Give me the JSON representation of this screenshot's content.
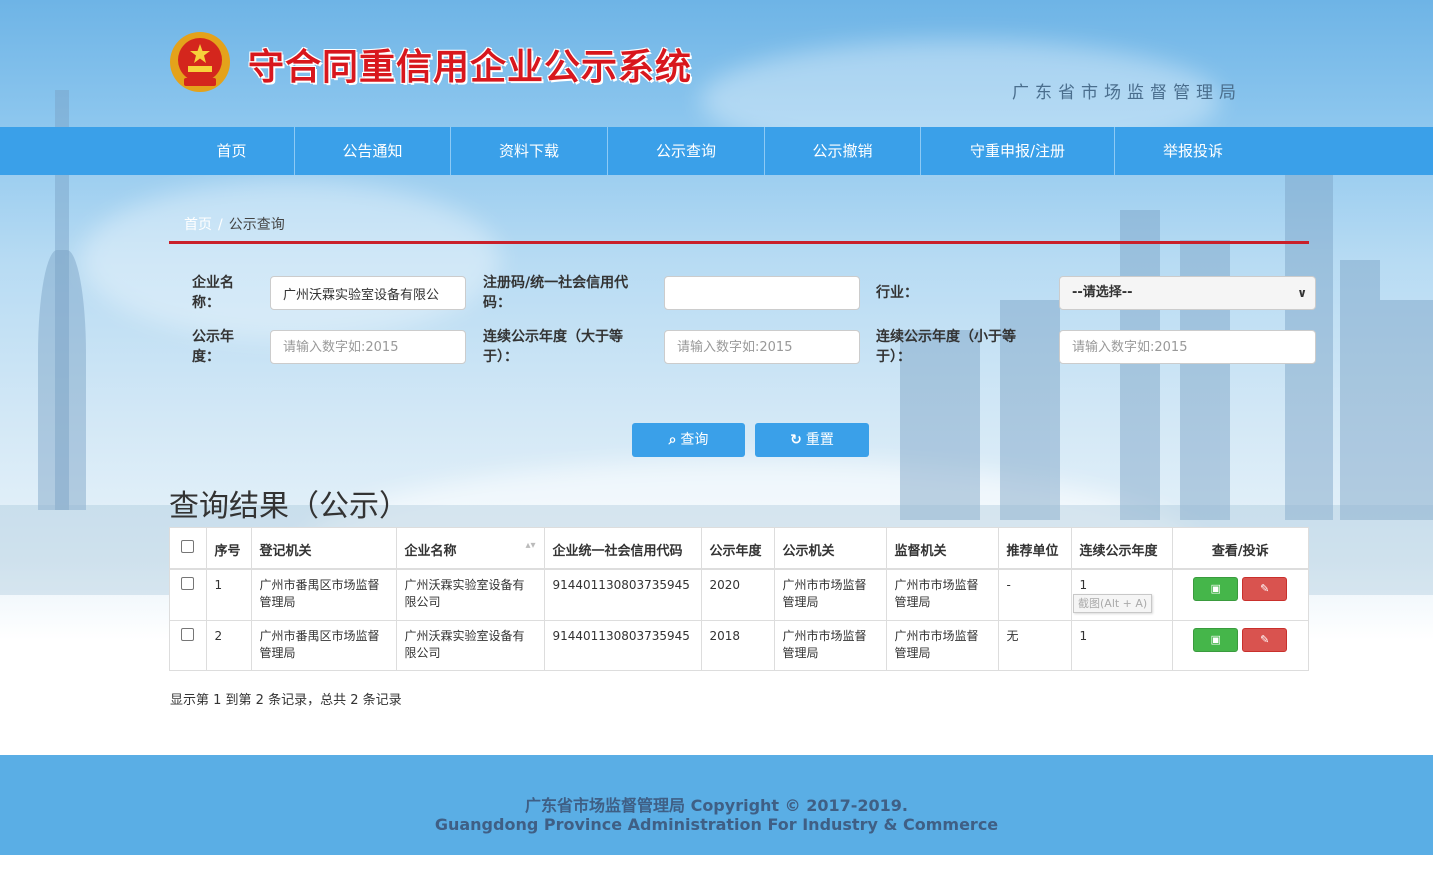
{
  "header": {
    "title": "守合同重信用企业公示系统",
    "subtitle": "广东省市场监督管理局"
  },
  "nav": {
    "items": [
      "首页",
      "公告通知",
      "资料下载",
      "公示查询",
      "公示撤销",
      "守重申报/注册",
      "举报投诉"
    ]
  },
  "breadcrumb": {
    "home": "首页",
    "sep": "/",
    "current": "公示查询"
  },
  "form": {
    "company_name_label_1": "企业名",
    "company_name_label_2": "称：",
    "company_name_value": "广州沃霖实验室设备有限公",
    "reg_code_label_1": "注册码/统一社会信用代",
    "reg_code_label_2": "码：",
    "reg_code_value": "",
    "industry_label": "行业：",
    "industry_selected": "--请选择--",
    "year_label_1": "公示年",
    "year_label_2": "度：",
    "year_placeholder": "请输入数字如:2015",
    "consec_gt_label_1": "连续公示年度（大于等",
    "consec_gt_label_2": "于）：",
    "consec_gt_placeholder": "请输入数字如:2015",
    "consec_lt_label_1": "连续公示年度（小于等",
    "consec_lt_label_2": "于）：",
    "consec_lt_placeholder": "请输入数字如:2015",
    "search_button": "查询",
    "reset_button": "重置"
  },
  "results": {
    "title": "查询结果（公示）",
    "columns": [
      "序号",
      "登记机关",
      "企业名称",
      "企业统一社会信用代码",
      "公示年度",
      "公示机关",
      "监督机关",
      "推荐单位",
      "连续公示年度",
      "查看/投诉"
    ],
    "rows": [
      {
        "no": "1",
        "reg_authority": "广州市番禺区市场监督管理局",
        "company": "广州沃霖实验室设备有限公司",
        "credit_code": "91440113080373594​5",
        "year": "2020",
        "publish_authority": "广州市市场监督管理局",
        "supervise_authority": "广州市市场监督管理局",
        "recommender": "-",
        "consecutive": "1"
      },
      {
        "no": "2",
        "reg_authority": "广州市番禺区市场监督管理局",
        "company": "广州沃霖实验室设备有限公司",
        "credit_code": "914401130803735945",
        "year": "2018",
        "publish_authority": "广州市市场监督管理局",
        "supervise_authority": "广州市市场监督管理局",
        "recommender": "无",
        "consecutive": "1"
      }
    ],
    "tooltip": "截图(Alt + A)",
    "pagination_info": "显示第 1 到第 2 条记录，总共 2 条记录"
  },
  "footer": {
    "line1": "广东省市场监督管理局 Copyright © 2017-2019.",
    "line2": "Guangdong Province Administration For Industry & Commerce"
  },
  "colors": {
    "nav": "#3aa0e9",
    "title_red": "#d8171d",
    "divider_red": "#c9202a",
    "footer": "#5aaee5",
    "view_button": "#45b64a",
    "complain_button": "#d9534f"
  }
}
